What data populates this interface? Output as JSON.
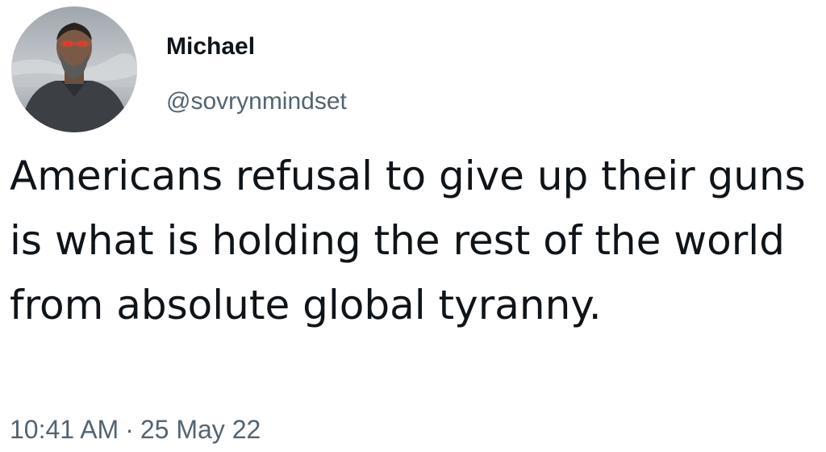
{
  "author": {
    "display_name": "Michael",
    "handle": "@sovrynmindset",
    "avatar_icon": "profile-photo"
  },
  "tweet": {
    "text": "Americans refusal to give up their guns is what is holding the rest of the world from absolute global tyranny."
  },
  "meta": {
    "time": "10:41 AM",
    "separator": "·",
    "date": "25 May 22"
  },
  "colors": {
    "text": "#0f1419",
    "secondary": "#536471",
    "background": "#ffffff"
  }
}
